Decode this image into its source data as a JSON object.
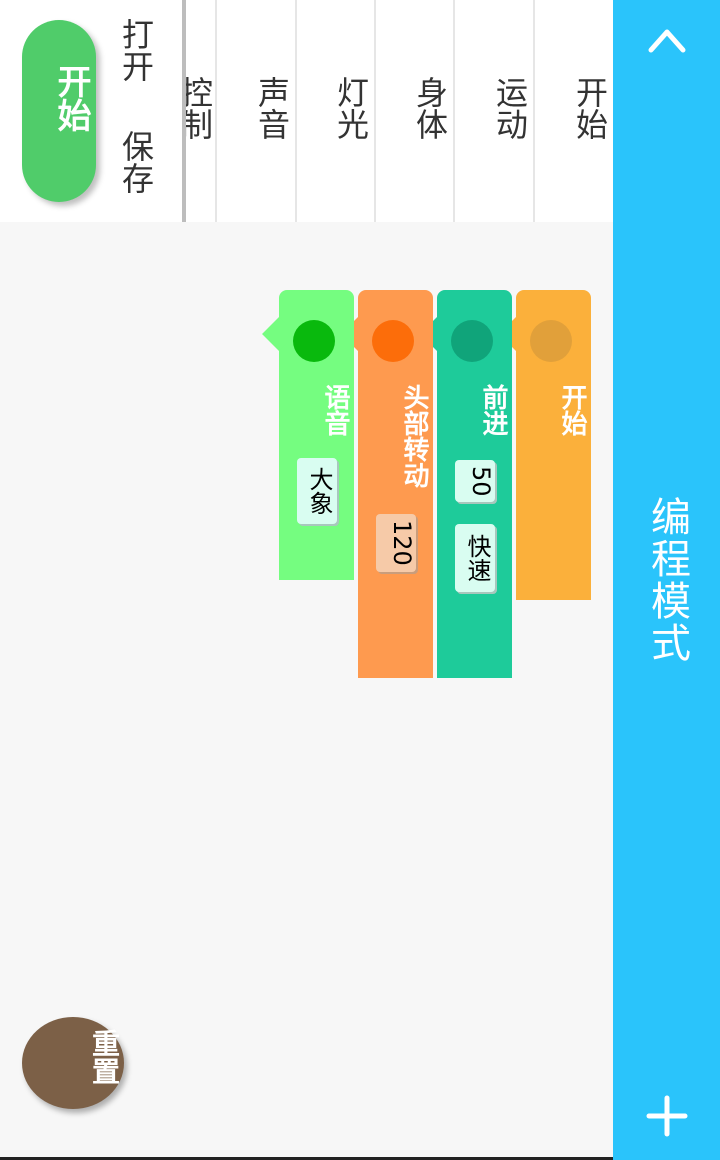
{
  "header": {
    "title": "编程模式",
    "collapse_icon": "chevron-up-icon",
    "add_icon": "plus-icon",
    "color": "#2ac4fb"
  },
  "categories": [
    {
      "label": "开始"
    },
    {
      "label": "运动"
    },
    {
      "label": "身体"
    },
    {
      "label": "灯光"
    },
    {
      "label": "声音"
    },
    {
      "label": "控制"
    }
  ],
  "file_actions": {
    "open": "打开",
    "save": "保存"
  },
  "start_button": {
    "label": "开始",
    "color": "#50cc6a"
  },
  "blocks": {
    "start": {
      "label": "开始",
      "color": "#fbb03b"
    },
    "forward": {
      "label": "前进",
      "distance": "50",
      "speed": "快速",
      "color": "#1ecb9a"
    },
    "head_turn": {
      "label": "头部转动",
      "angle": "120",
      "color": "#fe9a4f"
    },
    "voice": {
      "label": "语音",
      "sound": "大象",
      "color": "#75fd80"
    }
  },
  "reset_button": {
    "label": "重置",
    "color": "#7c6047"
  }
}
